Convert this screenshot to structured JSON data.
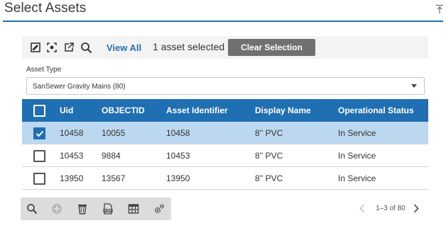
{
  "panel": {
    "title": "Select Assets"
  },
  "toolbar": {
    "view_all_label": "View All",
    "selection_text": "1 asset selected",
    "clear_selection_label": "Clear Selection",
    "icons": [
      "edit-selection-icon",
      "zoom-to-selection-icon",
      "open-external-icon",
      "search-icon"
    ]
  },
  "asset_type": {
    "label": "Asset Type",
    "selected_value": "SanSewer Gravity Mains (80)"
  },
  "grid": {
    "columns": [
      "Uid",
      "OBJECTID",
      "Asset Identifier",
      "Display Name",
      "Operational Status"
    ],
    "rows": [
      {
        "selected": true,
        "uid": "10458",
        "objectid": "10055",
        "asset_identifier": "10458",
        "display_name": "8'' PVC",
        "operational_status": "In Service"
      },
      {
        "selected": false,
        "uid": "10453",
        "objectid": "9884",
        "asset_identifier": "10453",
        "display_name": "8'' PVC",
        "operational_status": "In Service"
      },
      {
        "selected": false,
        "uid": "13950",
        "objectid": "13567",
        "asset_identifier": "13950",
        "display_name": "8'' PVC",
        "operational_status": "In Service"
      }
    ]
  },
  "bottom_toolbar": {
    "icons": [
      "search-icon",
      "add-icon",
      "delete-icon",
      "csv-export-icon",
      "table-icon",
      "settings-icon"
    ]
  },
  "pagination": {
    "text": "1–3 of 80"
  },
  "colors": {
    "accent": "#1f6fb2",
    "selected_row": "#bcd8f0",
    "clear_button": "#707070",
    "link": "#2472b8"
  }
}
